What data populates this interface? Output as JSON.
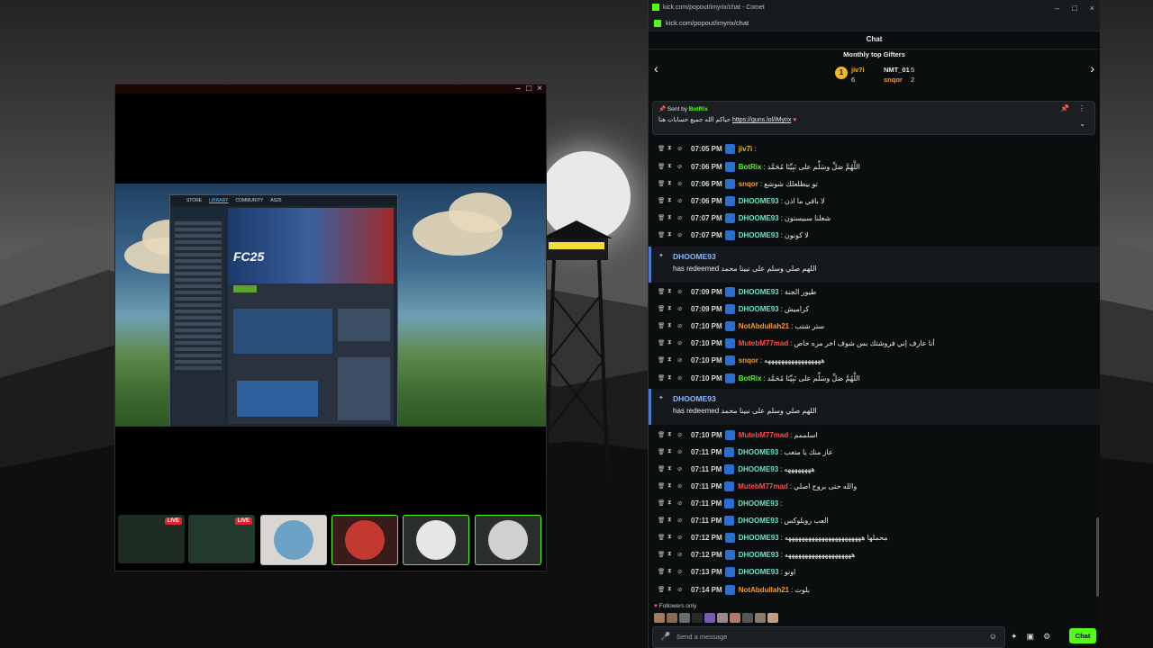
{
  "stream_window": {
    "controls": [
      "–",
      "□",
      "×"
    ],
    "game_title": "FC25",
    "steam_tabs": [
      "STORE",
      "LIBRARY",
      "COMMUNITY",
      "AS25"
    ],
    "live_badge": "LIVE",
    "live_badge2": "LIVE"
  },
  "chat_window": {
    "title": "kick.com/popout/imyrix/chat - Comet",
    "controls": [
      "–",
      "□",
      "×"
    ],
    "url": "kick.com/popout/imyrix/chat",
    "header": "Chat",
    "gifters": {
      "title": "Monthly top Gifters",
      "rank_icon": "1",
      "first": {
        "name": "jiv7i",
        "count": "6"
      },
      "second": {
        "name": "NMT_01",
        "count": "5"
      },
      "third": {
        "name": "snqor",
        "count": "2"
      }
    },
    "pinned": {
      "sent_by_label": "Sent by",
      "sender": "BotRix",
      "text": "حياكم الله جميع حسابات هنا",
      "link": "https://guns.lol/iMyrix",
      "heart": "♥"
    },
    "messages": [
      {
        "time": "07:05 PM",
        "user": "jiv7i",
        "text": "",
        "color": "#f2b71c"
      },
      {
        "time": "07:06 PM",
        "user": "BotRix",
        "text": "اللَّهُمَّ صَلِّ وسَلِّم على نَبِيِّنَا مُحَمَّد",
        "color": "#53fc18"
      },
      {
        "time": "07:06 PM",
        "user": "snqor",
        "text": "تو بيطلعلك شوشع",
        "color": "#f59b2a"
      },
      {
        "time": "07:06 PM",
        "user": "DHOOME93",
        "text": "لا باقي ما اذن",
        "color": "#6fe3c2"
      },
      {
        "time": "07:07 PM",
        "user": "DHOOME93",
        "text": "شغلنا سبيستون",
        "color": "#6fe3c2"
      },
      {
        "time": "07:07 PM",
        "user": "DHOOME93",
        "text": "لا كونون",
        "color": "#6fe3c2"
      },
      {
        "time": "07:09 PM",
        "user": "DHOOME93",
        "text": "طيور الجنة",
        "color": "#6fe3c2"
      },
      {
        "time": "07:09 PM",
        "user": "DHOOME93",
        "text": "كراميش",
        "color": "#6fe3c2"
      },
      {
        "time": "07:10 PM",
        "user": "NotAbdullah21",
        "text": "ستر شتب",
        "color": "#f59b2a"
      },
      {
        "time": "07:10 PM",
        "user": "MutebM77mad",
        "text": "أنا عارف إني فروشتك بس شوف اخر مره خاص",
        "color": "#ff4a4a"
      },
      {
        "time": "07:10 PM",
        "user": "snqor",
        "text": "هههههههههههههههههه",
        "color": "#f59b2a"
      },
      {
        "time": "07:10 PM",
        "user": "BotRix",
        "text": "اللَّهُمَّ صَلِّ وسَلِّم على نَبِيِّنَا مُحَمَّد",
        "color": "#53fc18"
      },
      {
        "time": "07:10 PM",
        "user": "MutebM77mad",
        "text": "اسلممم",
        "color": "#ff4a4a"
      },
      {
        "time": "07:11 PM",
        "user": "DHOOME93",
        "text": "عاز منك يا متعب",
        "color": "#6fe3c2"
      },
      {
        "time": "07:11 PM",
        "user": "DHOOME93",
        "text": "ههههههههه",
        "color": "#6fe3c2"
      },
      {
        "time": "07:11 PM",
        "user": "MutebM77mad",
        "text": "والله حتى بروح اصلي",
        "color": "#ff4a4a"
      },
      {
        "time": "07:11 PM",
        "user": "DHOOME93",
        "text": "",
        "color": "#6fe3c2"
      },
      {
        "time": "07:11 PM",
        "user": "DHOOME93",
        "text": "العب روبلوكس",
        "color": "#6fe3c2"
      },
      {
        "time": "07:12 PM",
        "user": "DHOOME93",
        "text": "محملها هههههههههههههههههههههههه",
        "color": "#6fe3c2"
      },
      {
        "time": "07:12 PM",
        "user": "DHOOME93",
        "text": "ههههههههههههههههههههه",
        "color": "#6fe3c2"
      },
      {
        "time": "07:13 PM",
        "user": "DHOOME93",
        "text": "اونو",
        "color": "#6fe3c2"
      },
      {
        "time": "07:14 PM",
        "user": "NotAbdullah21",
        "text": "بلوت",
        "color": "#f59b2a"
      }
    ],
    "redeems": [
      {
        "user": "DHOOME93",
        "text": "has redeemed اللهم صلي وسلم على نبينا محمد"
      },
      {
        "user": "DHOOME93",
        "text": "has redeemed اللهم صلي وسلم على نبينا محمد"
      }
    ],
    "footer": {
      "followers_only": "Followers only",
      "placeholder": "Send a message",
      "chat_button": "Chat"
    }
  }
}
